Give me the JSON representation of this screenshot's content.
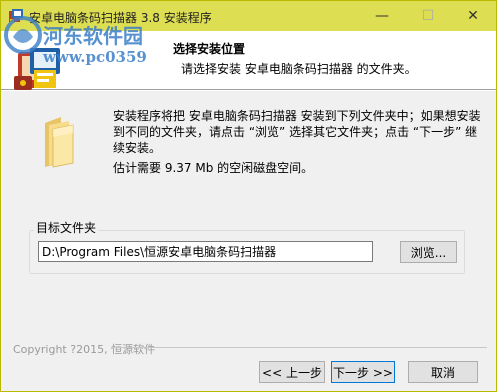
{
  "window": {
    "title": "安卓电脑条码扫描器 3.8 安装程序",
    "minimize_glyph": "—",
    "maximize_glyph": "☐",
    "close_glyph": "✕"
  },
  "header": {
    "title": "选择安装位置",
    "subtitle": "请选择安装 安卓电脑条码扫描器 的文件夹。"
  },
  "watermark": {
    "line1": "河东软件园",
    "line2": "www.pc0359"
  },
  "body": {
    "description": "安装程序将把 安卓电脑条码扫描器 安装到下列文件夹中；如果想安装到不同的文件夹，请点击 “浏览” 选择其它文件夹；点击 “下一步” 继续安装。",
    "space_required": "估计需要 9.37 Mb 的空闲磁盘空间。"
  },
  "destination": {
    "label": "目标文件夹",
    "path": "D:\\Program Files\\恒源安卓电脑条码扫描器",
    "browse_label": "浏览..."
  },
  "footer": {
    "copyright": "Copyright  ?2015, 恒源软件"
  },
  "buttons": {
    "back": "<< 上一步",
    "next": "下一步 >>",
    "cancel": "取消"
  },
  "icons": {
    "title": "app-icon",
    "header": "installer-box-icon",
    "folder": "folder-icon",
    "watermark": "watermark-logo-icon"
  },
  "colors": {
    "titlebar": "#dede52",
    "window_border": "#b9b900",
    "watermark": "#3a7ec8",
    "default_button_border": "#0078d7"
  }
}
